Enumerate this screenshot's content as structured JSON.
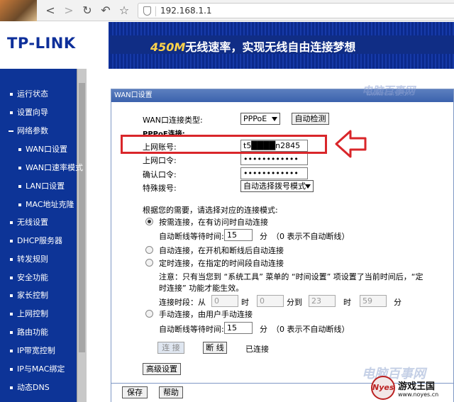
{
  "browser": {
    "url": "192.168.1.1"
  },
  "header": {
    "logo": "TP-LINK",
    "slogan_speed": "450M",
    "slogan_text": "无线速率，实现无线自由连接梦想"
  },
  "sidebar": {
    "items": [
      {
        "label": "运行状态",
        "type": "top"
      },
      {
        "label": "设置向导",
        "type": "top"
      },
      {
        "label": "网络参数",
        "type": "open"
      },
      {
        "label": "WAN口设置",
        "type": "sub"
      },
      {
        "label": "WAN口速率模式",
        "type": "sub"
      },
      {
        "label": "LAN口设置",
        "type": "sub"
      },
      {
        "label": "MAC地址克隆",
        "type": "sub"
      },
      {
        "label": "无线设置",
        "type": "top"
      },
      {
        "label": "DHCP服务器",
        "type": "top"
      },
      {
        "label": "转发规则",
        "type": "top"
      },
      {
        "label": "安全功能",
        "type": "top"
      },
      {
        "label": "家长控制",
        "type": "top"
      },
      {
        "label": "上网控制",
        "type": "top"
      },
      {
        "label": "路由功能",
        "type": "top"
      },
      {
        "label": "IP带宽控制",
        "type": "top"
      },
      {
        "label": "IP与MAC绑定",
        "type": "top"
      },
      {
        "label": "动态DNS",
        "type": "top"
      }
    ]
  },
  "panel": {
    "title": "WAN口设置",
    "conn_type_label": "WAN口连接类型:",
    "conn_type_value": "PPPoE",
    "auto_detect": "自动检测",
    "pppoe_header": "PPPoE连接:",
    "account_label": "上网账号:",
    "account_value": "t5████n2845",
    "password_label": "上网口令:",
    "password_value": "••••••••••••",
    "confirm_label": "确认口令:",
    "confirm_value": "••••••••••••",
    "dial_label": "特殊拨号:",
    "dial_value": "自动选择拨号模式",
    "mode_intro": "根据您的需要，请选择对应的连接模式:",
    "mode_on_demand": "按需连接，在有访问时自动连接",
    "idle_label": "自动断线等待时间:",
    "idle_value": "15",
    "idle_unit": "分",
    "idle_hint": "（0 表示不自动断线）",
    "mode_auto": "自动连接，在开机和断线后自动连接",
    "mode_timed": "定时连接，在指定的时间段自动连接",
    "timed_note_line1": "注意：只有当您到 “系统工具” 菜单的 “时间设置” 项设置了当前时间后，“定",
    "timed_note_line2": "时连接” 功能才能生效。",
    "period_label": "连接时段：从",
    "period_from_h": "0",
    "period_h1": "时",
    "period_from_m": "0",
    "period_to": "分到",
    "period_to_h": "23",
    "period_h2": "时",
    "period_to_m": "59",
    "period_m2": "分",
    "mode_manual": "手动连接，由用户手动连接",
    "manual_idle_label": "自动断线等待时间:",
    "manual_idle_value": "15",
    "manual_idle_unit": "分",
    "manual_idle_hint": "（0 表示不自动断线）",
    "connect_btn": "连 接",
    "disconnect_btn": "断 线",
    "status": "已连接",
    "advanced_btn": "高级设置"
  },
  "footer": {
    "save": "保存",
    "help": "帮助"
  },
  "watermarks": {
    "top": "电脑百事网",
    "top_url": "WWW.PC841.COM",
    "bottom": "电脑百事网",
    "bottom_logo": "Nyes",
    "bottom_site": "游戏王国",
    "bottom_url": "www.noyes.cn"
  },
  "colors": {
    "brand_blue": "#0e2f9a",
    "highlight_red": "#d9262a",
    "slogan_yellow": "#ffd34a"
  }
}
